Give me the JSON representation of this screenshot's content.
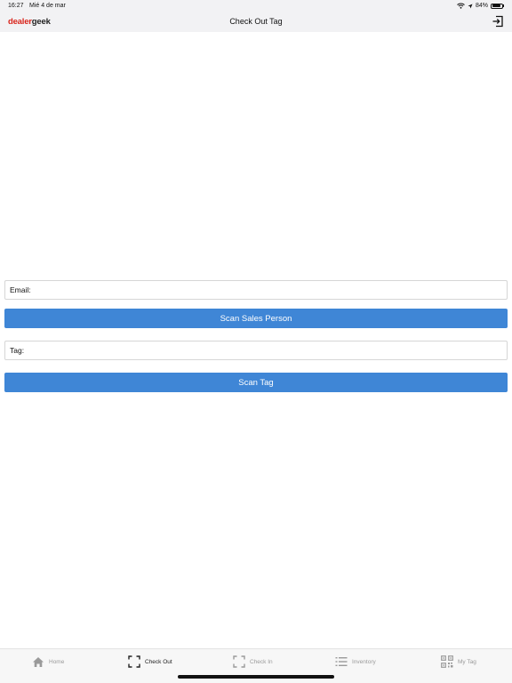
{
  "status_bar": {
    "time": "16:27",
    "date": "Mié 4 de mar",
    "battery": "84%",
    "battery_level": 0.84
  },
  "nav": {
    "logo_part1": "dealer",
    "logo_part2": "geek",
    "title": "Check Out Tag",
    "logout_icon": "logout-icon"
  },
  "form": {
    "email_label": "Email:",
    "email_value": "",
    "scan_sales_person_label": "Scan Sales Person",
    "tag_label": "Tag:",
    "tag_value": "",
    "scan_tag_label": "Scan Tag"
  },
  "tabs": [
    {
      "label": "Home",
      "icon": "home-icon",
      "active": false
    },
    {
      "label": "Check Out",
      "icon": "scan-frame-icon",
      "active": true
    },
    {
      "label": "Check In",
      "icon": "scan-frame-icon",
      "active": false
    },
    {
      "label": "Inventory",
      "icon": "list-icon",
      "active": false
    },
    {
      "label": "My Tag",
      "icon": "qr-code-icon",
      "active": false
    }
  ],
  "colors": {
    "accent": "#3f86d6",
    "logo_red": "#d9251c",
    "bar_bg": "#f2f2f4"
  }
}
